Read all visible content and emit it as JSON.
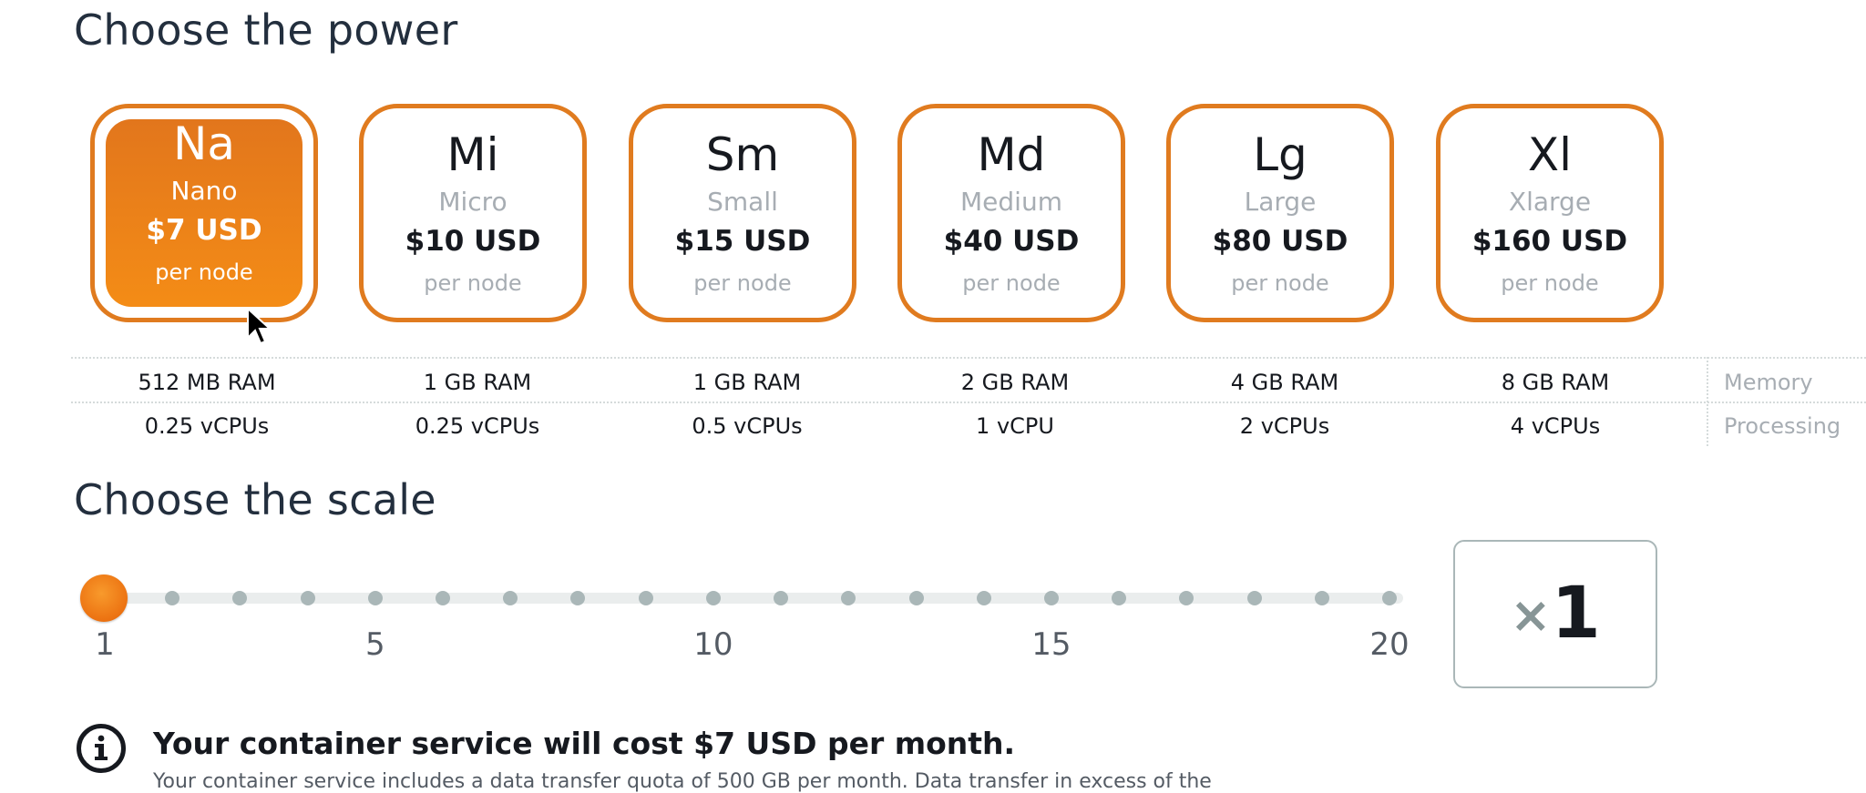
{
  "power": {
    "heading": "Choose the power",
    "options": [
      {
        "abbr": "Na",
        "name": "Nano",
        "price": "$7 USD",
        "per": "per node",
        "ram": "512 MB RAM",
        "cpu": "0.25 vCPUs",
        "selected": true
      },
      {
        "abbr": "Mi",
        "name": "Micro",
        "price": "$10 USD",
        "per": "per node",
        "ram": "1 GB RAM",
        "cpu": "0.25 vCPUs",
        "selected": false
      },
      {
        "abbr": "Sm",
        "name": "Small",
        "price": "$15 USD",
        "per": "per node",
        "ram": "1 GB RAM",
        "cpu": "0.5 vCPUs",
        "selected": false
      },
      {
        "abbr": "Md",
        "name": "Medium",
        "price": "$40 USD",
        "per": "per node",
        "ram": "2 GB RAM",
        "cpu": "1 vCPU",
        "selected": false
      },
      {
        "abbr": "Lg",
        "name": "Large",
        "price": "$80 USD",
        "per": "per node",
        "ram": "4 GB RAM",
        "cpu": "2 vCPUs",
        "selected": false
      },
      {
        "abbr": "Xl",
        "name": "Xlarge",
        "price": "$160 USD",
        "per": "per node",
        "ram": "8 GB RAM",
        "cpu": "4 vCPUs",
        "selected": false
      }
    ],
    "row_labels": {
      "memory": "Memory",
      "processing": "Processing"
    }
  },
  "scale": {
    "heading": "Choose the scale",
    "min": 1,
    "max": 20,
    "value": 1,
    "tick_labels": [
      "1",
      "5",
      "10",
      "15",
      "20"
    ],
    "multiplier_symbol": "×",
    "display_value": "1"
  },
  "cost": {
    "icon": "info-icon",
    "message": "Your container service will cost $7 USD per month.",
    "sub": "Your container service includes a data transfer quota of 500 GB per month. Data transfer in excess of the"
  },
  "colors": {
    "accent": "#ec7211",
    "card_border": "#e07b1f",
    "muted_text": "#a7adb3"
  }
}
